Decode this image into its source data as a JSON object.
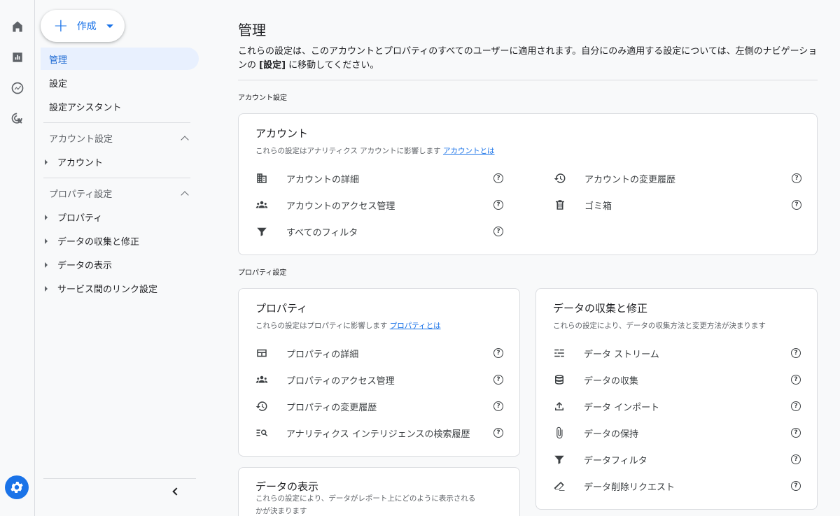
{
  "rail": {
    "items": [
      {
        "icon": "home-icon"
      },
      {
        "icon": "reports-icon"
      },
      {
        "icon": "explore-icon"
      },
      {
        "icon": "advertising-icon"
      }
    ],
    "bottom_icon": "settings-icon"
  },
  "nav": {
    "create_label": "作成",
    "items": [
      {
        "label": "管理",
        "active": true
      },
      {
        "label": "設定"
      },
      {
        "label": "設定アシスタント"
      }
    ],
    "account_section": {
      "title": "アカウント設定",
      "items": [
        "アカウント"
      ]
    },
    "property_section": {
      "title": "プロパティ設定",
      "items": [
        "プロパティ",
        "データの収集と修正",
        "データの表示",
        "サービス間のリンク設定"
      ]
    }
  },
  "main": {
    "title": "管理",
    "description_part1": "これらの設定は、このアカウントとプロパティのすべてのユーザーに適用されます。自分にのみ適用する設定については、左側のナビゲーションの ",
    "description_bold": "[設定]",
    "description_part2": " に移動してください。",
    "account_settings_label": "アカウント設定",
    "property_settings_label": "プロパティ設定",
    "account_card": {
      "title": "アカウント",
      "subtitle": "これらの設定はアナリティクス アカウントに影響します",
      "link": "アカウントとは",
      "left_items": [
        {
          "icon": "building-icon",
          "label": "アカウントの詳細"
        },
        {
          "icon": "group-icon",
          "label": "アカウントのアクセス管理"
        },
        {
          "icon": "filter-icon",
          "label": "すべてのフィルタ"
        }
      ],
      "right_items": [
        {
          "icon": "history-icon",
          "label": "アカウントの変更履歴"
        },
        {
          "icon": "trash-icon",
          "label": "ゴミ箱"
        }
      ]
    },
    "property_card": {
      "title": "プロパティ",
      "subtitle": "これらの設定はプロパティに影響します",
      "link": "プロパティとは",
      "items": [
        {
          "icon": "property-details-icon",
          "label": "プロパティの詳細"
        },
        {
          "icon": "group-icon",
          "label": "プロパティのアクセス管理"
        },
        {
          "icon": "history-icon",
          "label": "プロパティの変更履歴"
        },
        {
          "icon": "search-history-icon",
          "label": "アナリティクス インテリジェンスの検索履歴"
        }
      ]
    },
    "data_collection_card": {
      "title": "データの収集と修正",
      "subtitle": "これらの設定により、データの収集方法と変更方法が決まります",
      "items": [
        {
          "icon": "stream-icon",
          "label": "データ ストリーム"
        },
        {
          "icon": "database-icon",
          "label": "データの収集"
        },
        {
          "icon": "upload-icon",
          "label": "データ インポート"
        },
        {
          "icon": "retention-icon",
          "label": "データの保持"
        },
        {
          "icon": "filter-icon",
          "label": "データフィルタ"
        },
        {
          "icon": "eraser-icon",
          "label": "データ削除リクエスト"
        }
      ]
    },
    "data_display_card": {
      "title": "データの表示",
      "subtitle_line1": "これらの設定により、データがレポート上にどのように表示される",
      "subtitle_line2": "かが決まります"
    },
    "help_glyph": "?"
  }
}
